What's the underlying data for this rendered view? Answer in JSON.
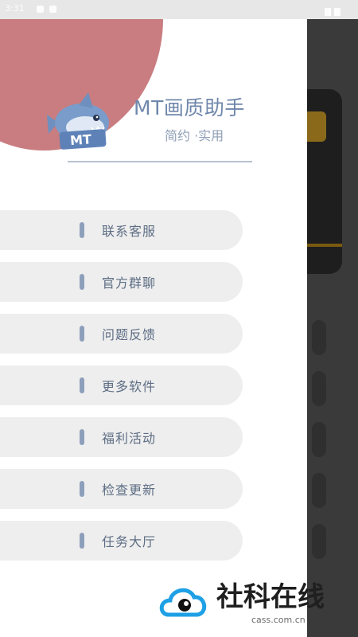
{
  "status_bar": {
    "time": "3:31"
  },
  "header": {
    "title": "MT画质助手",
    "subtitle": "简约 ·实用",
    "mascot_badge": "MT"
  },
  "menu": {
    "items": [
      {
        "label": "联系客服",
        "icon": "bar-marker-icon"
      },
      {
        "label": "官方群聊",
        "icon": "bar-marker-icon"
      },
      {
        "label": "问题反馈",
        "icon": "bar-marker-icon"
      },
      {
        "label": "更多软件",
        "icon": "bar-marker-icon"
      },
      {
        "label": "福利活动",
        "icon": "bar-marker-icon"
      },
      {
        "label": "检查更新",
        "icon": "bar-marker-icon"
      },
      {
        "label": "任务大厅",
        "icon": "bar-marker-icon"
      }
    ]
  },
  "watermark": {
    "text": "社科在线",
    "url": "cass.com.cn"
  },
  "colors": {
    "accent": "#c97d80",
    "title": "#6f87ab",
    "pill_bg": "#eeeeee",
    "marker": "#8d9fbb"
  }
}
